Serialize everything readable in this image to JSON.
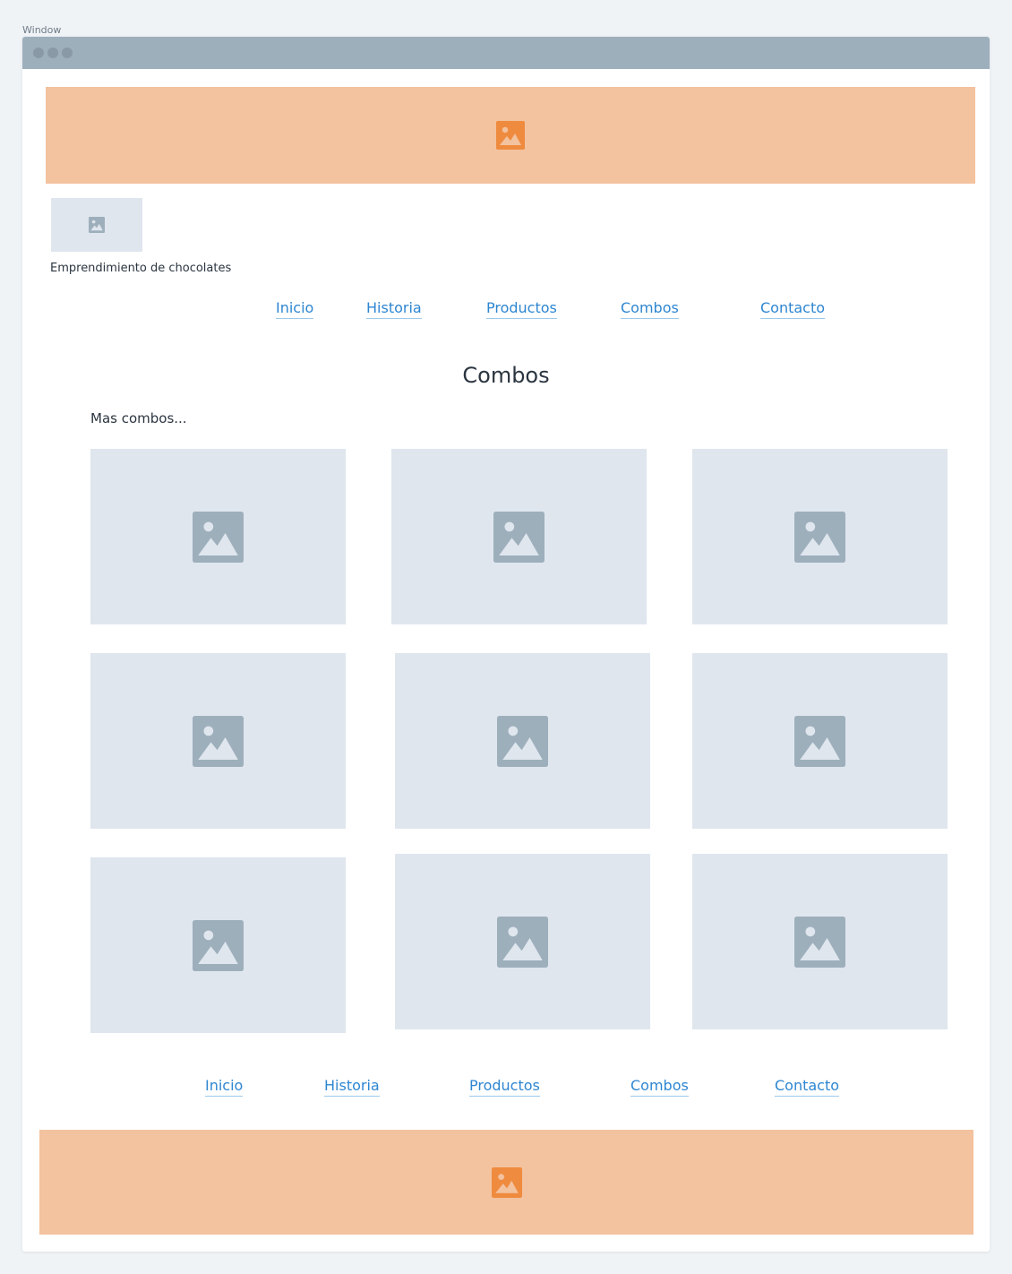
{
  "window": {
    "label": "Window"
  },
  "header": {
    "logo_caption": "Emprendimiento de chocolates"
  },
  "nav_top": [
    {
      "label": "Inicio"
    },
    {
      "label": "Historia"
    },
    {
      "label": "Productos"
    },
    {
      "label": "Combos"
    },
    {
      "label": "Contacto"
    }
  ],
  "main": {
    "title": "Combos",
    "subtitle": "Mas combos..."
  },
  "nav_bottom": [
    {
      "label": "Inicio"
    },
    {
      "label": "Historia"
    },
    {
      "label": "Productos"
    },
    {
      "label": "Combos"
    },
    {
      "label": "Contacto"
    }
  ],
  "colors": {
    "banner": "#f3c29f",
    "banner_icon": "#ef8b3f",
    "placeholder": "#dfe6ee",
    "placeholder_icon": "#9eafbc",
    "link": "#2e86d1"
  },
  "icons": {
    "banner": "image-icon",
    "placeholder": "image-icon"
  }
}
